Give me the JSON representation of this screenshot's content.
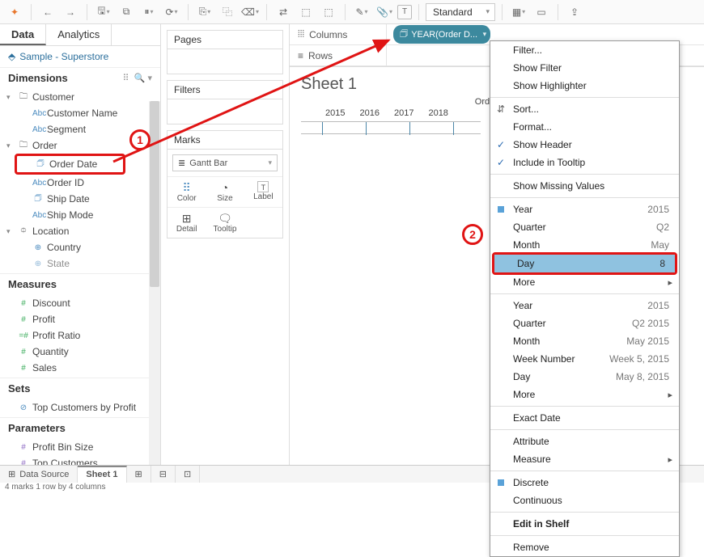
{
  "toolbar": {
    "fit_label": "Standard"
  },
  "data_panel": {
    "tabs": [
      "Data",
      "Analytics"
    ],
    "source": "Sample - Superstore",
    "dimensions_label": "Dimensions",
    "dimensions": {
      "customer_group": "Customer",
      "customer_name": "Customer Name",
      "segment": "Segment",
      "order_group": "Order",
      "order_date": "Order Date",
      "order_id": "Order ID",
      "ship_date": "Ship Date",
      "ship_mode": "Ship Mode",
      "location_group": "Location",
      "country": "Country",
      "state": "State"
    },
    "measures_label": "Measures",
    "measures": [
      "Discount",
      "Profit",
      "Profit Ratio",
      "Quantity",
      "Sales"
    ],
    "sets_label": "Sets",
    "sets": [
      "Top Customers by Profit"
    ],
    "parameters_label": "Parameters",
    "parameters": [
      "Profit Bin Size",
      "Top Customers"
    ]
  },
  "cards": {
    "pages": "Pages",
    "filters": "Filters",
    "marks": "Marks",
    "mark_type": "Gantt Bar",
    "btns": {
      "color": "Color",
      "size": "Size",
      "label": "Label",
      "detail": "Detail",
      "tooltip": "Tooltip"
    }
  },
  "shelves": {
    "columns_label": "Columns",
    "rows_label": "Rows",
    "col_pill": "YEAR(Order D..."
  },
  "sheet": {
    "title": "Sheet 1",
    "field_header": "Order Date",
    "years": [
      "2015",
      "2016",
      "2017",
      "2018"
    ]
  },
  "ctx": {
    "filter": "Filter...",
    "show_filter": "Show Filter",
    "show_hl": "Show Highlighter",
    "sort": "Sort...",
    "format": "Format...",
    "show_header": "Show Header",
    "incl_tooltip": "Include in Tooltip",
    "show_missing": "Show Missing Values",
    "g1": [
      {
        "k": "Year",
        "v": "2015"
      },
      {
        "k": "Quarter",
        "v": "Q2"
      },
      {
        "k": "Month",
        "v": "May"
      },
      {
        "k": "Day",
        "v": "8"
      },
      {
        "k": "More",
        "v": ""
      }
    ],
    "g2": [
      {
        "k": "Year",
        "v": "2015"
      },
      {
        "k": "Quarter",
        "v": "Q2 2015"
      },
      {
        "k": "Month",
        "v": "May 2015"
      },
      {
        "k": "Week Number",
        "v": "Week 5, 2015"
      },
      {
        "k": "Day",
        "v": "May 8, 2015"
      },
      {
        "k": "More",
        "v": ""
      }
    ],
    "exact": "Exact Date",
    "attribute": "Attribute",
    "measure": "Measure",
    "discrete": "Discrete",
    "continuous": "Continuous",
    "edit": "Edit in Shelf",
    "remove": "Remove"
  },
  "bottom": {
    "datasource": "Data Source",
    "sheet1": "Sheet 1"
  },
  "status": "4 marks    1 row by 4 columns",
  "callouts": {
    "one": "1",
    "two": "2"
  }
}
